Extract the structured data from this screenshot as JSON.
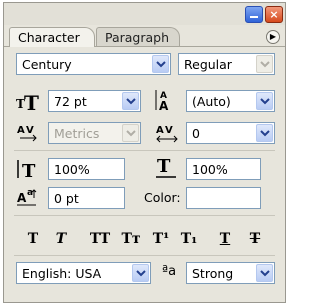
{
  "tabs": [
    {
      "label": "Character",
      "active": true
    },
    {
      "label": "Paragraph",
      "active": false
    }
  ],
  "font_family": {
    "value": "Century"
  },
  "font_style": {
    "value": "Regular"
  },
  "font_size": {
    "value": "72 pt"
  },
  "leading": {
    "value": "(Auto)"
  },
  "kerning": {
    "value": "Metrics",
    "disabled": true
  },
  "tracking": {
    "value": "0"
  },
  "vertical_scale": {
    "value": "100%"
  },
  "horizontal_scale": {
    "value": "100%"
  },
  "baseline_shift": {
    "value": "0 pt"
  },
  "color": {
    "label": "Color:",
    "value": "#ffffff"
  },
  "style_buttons": [
    {
      "name": "faux-bold",
      "glyph": "T"
    },
    {
      "name": "faux-italic",
      "glyph": "T"
    },
    {
      "name": "all-caps",
      "glyph": "TT"
    },
    {
      "name": "small-caps",
      "glyph": "Tт"
    },
    {
      "name": "superscript",
      "glyph": "T¹"
    },
    {
      "name": "subscript",
      "glyph": "T₁"
    },
    {
      "name": "underline",
      "glyph": "T"
    },
    {
      "name": "strikethrough",
      "glyph": "T"
    }
  ],
  "language": {
    "value": "English: USA"
  },
  "antialiasing": {
    "icon_text": "ªa",
    "value": "Strong"
  },
  "colors": {
    "panel": "#e7e5dc",
    "accent_blue": "#2f63d8",
    "close_red": "#d6491c"
  }
}
